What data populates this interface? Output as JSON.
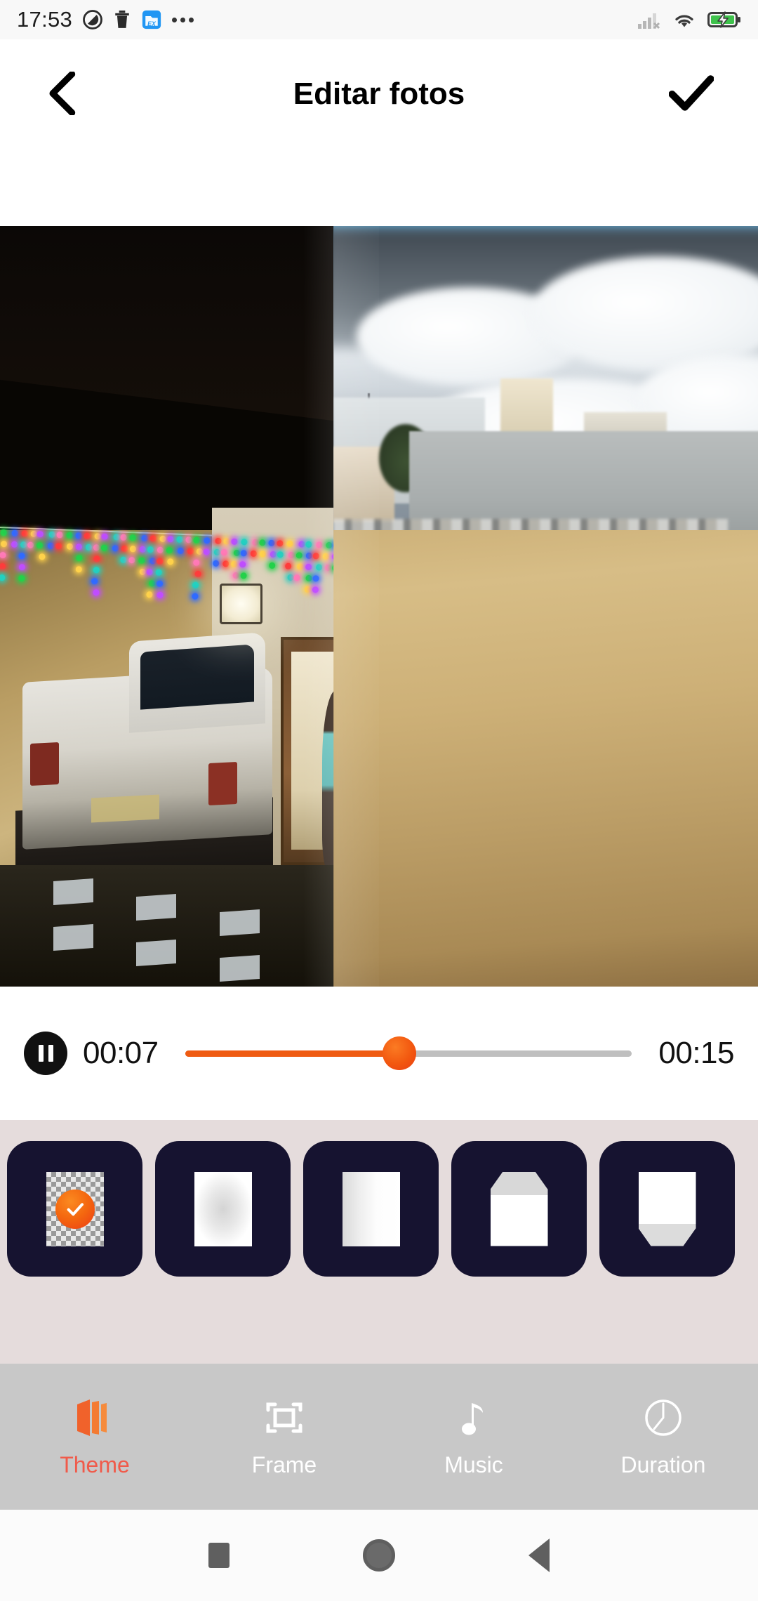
{
  "status_bar": {
    "time": "17:53",
    "notification_icons": [
      "do-not-disturb-icon",
      "trash-icon",
      "ex-file-manager-icon",
      "more-notifications-icon"
    ],
    "system_icons": [
      "signal-no-sim-icon",
      "wifi-icon",
      "battery-charging-icon"
    ],
    "battery_color": "#3fc24c"
  },
  "header": {
    "back_label": "back",
    "title": "Editar fotos",
    "done_label": "done"
  },
  "preview": {
    "description": "photo slideshow preview with crossfade transition",
    "left_scene": "night house with christmas lights and white pickup truck",
    "right_scene": "daytime sandy courtyard with concrete wall and cloudy sky"
  },
  "player": {
    "play_state": "pause",
    "current_time": "00:07",
    "total_time": "00:15",
    "progress_percent": 48,
    "accent_color": "#ef5b12",
    "track_color": "#bfbfbf"
  },
  "themes": {
    "background_color": "#e5dcdc",
    "tile_color": "#161330",
    "selected_index": 0,
    "items": [
      {
        "name": "theme-none",
        "style": "checker",
        "selected": true
      },
      {
        "name": "theme-vignette",
        "style": "vignette",
        "selected": false
      },
      {
        "name": "theme-linear",
        "style": "linear",
        "selected": false
      },
      {
        "name": "theme-pentagon",
        "style": "pentagon",
        "selected": false
      },
      {
        "name": "theme-trapezoid",
        "style": "trapezoid",
        "selected": false
      }
    ]
  },
  "toolbar": {
    "background_color": "#c8c8c8",
    "active_color": "#f05a4a",
    "inactive_color": "#ffffff",
    "items": [
      {
        "label": "Theme",
        "icon": "theme-layers-icon",
        "active": true
      },
      {
        "label": "Frame",
        "icon": "frame-crop-icon",
        "active": false
      },
      {
        "label": "Music",
        "icon": "music-note-icon",
        "active": false
      },
      {
        "label": "Duration",
        "icon": "clock-icon",
        "active": false
      }
    ]
  },
  "navbar": {
    "items": [
      "recents-square-icon",
      "home-circle-icon",
      "back-triangle-icon"
    ]
  }
}
